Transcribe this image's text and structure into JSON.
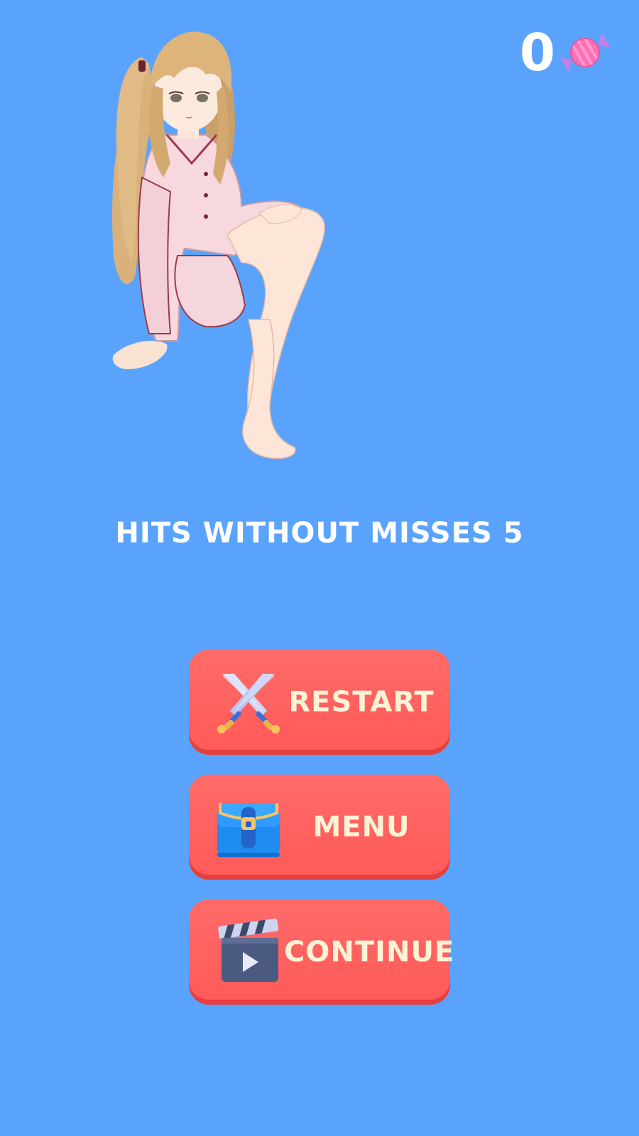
{
  "score": {
    "value": "0",
    "icon": "candy-icon",
    "color": "#ffffff"
  },
  "character": {
    "icon": "anime-girl-character"
  },
  "result": {
    "text": "HITS WITHOUT MISSES 5"
  },
  "buttons": {
    "restart": {
      "label": "RESTART",
      "icon": "crossed-swords-icon"
    },
    "menu": {
      "label": "MENU",
      "icon": "backpack-icon"
    },
    "continue": {
      "label": "CONTINUE",
      "icon": "clapperboard-play-icon"
    }
  },
  "colors": {
    "background": "#5aa3fc",
    "button": "#ff5a58",
    "button_shadow": "#e5403f",
    "button_text": "#fff3d6"
  }
}
